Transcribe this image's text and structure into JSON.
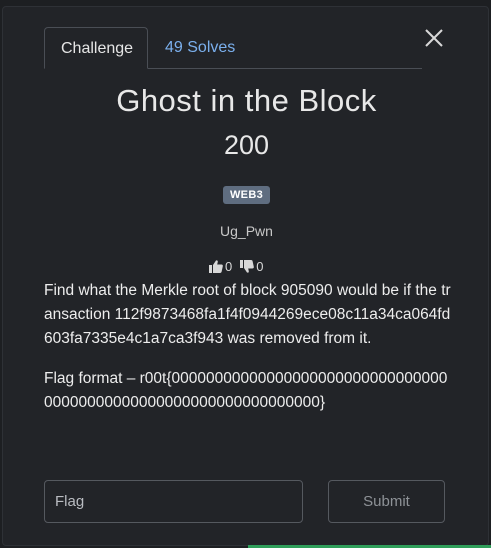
{
  "tabs": {
    "challenge_label": "Challenge",
    "solves_label": "49 Solves"
  },
  "challenge": {
    "title": "Ghost in the Block",
    "points": "200",
    "tag": "WEB3",
    "author": "Ug_Pwn"
  },
  "votes": {
    "up": "0",
    "down": "0"
  },
  "description": {
    "paragraph1": "Find what the Merkle root of block 905090 would be if the transaction 112f9873468fa1f4f0944269ece08c11a34ca064fd603fa7335e4c1a7ca3f943 was removed from it.",
    "paragraph2": "Flag format – r00t{0000000000000000000000000000000000000000000000000000000000000000}"
  },
  "form": {
    "flag_placeholder": "Flag",
    "submit_label": "Submit"
  },
  "colors": {
    "background": "#1d1f22",
    "modal": "#222428",
    "link": "#7bb0ee",
    "tag": "#5f6d80"
  }
}
